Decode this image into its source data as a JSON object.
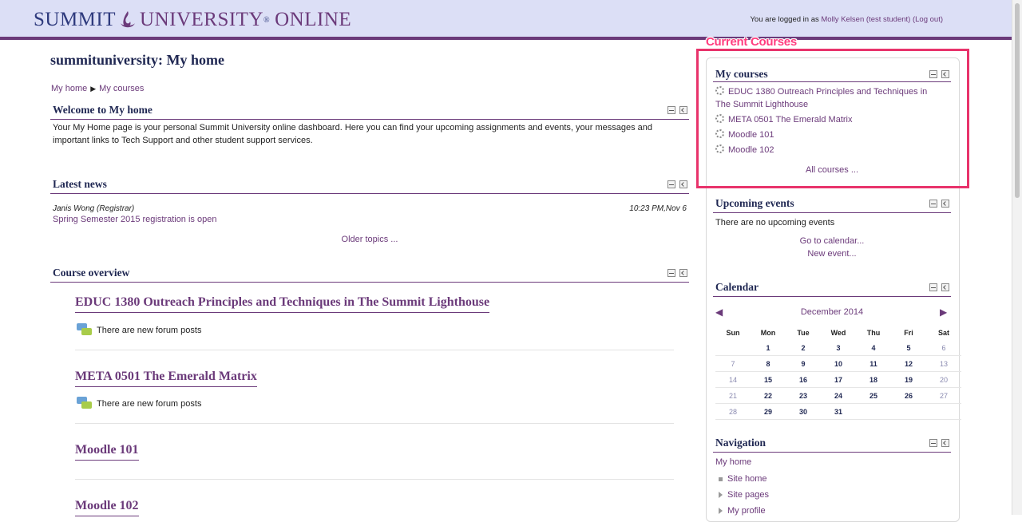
{
  "header": {
    "logo_summit": "SUMMIT",
    "logo_university": "UNIVERSITY",
    "logo_reg": "®",
    "logo_online": "ONLINE",
    "login_prefix": "You are logged in as ",
    "login_user": "Molly Kelsen (test student)",
    "logout": "(Log out)"
  },
  "page": {
    "title": "summituniversity: My home",
    "breadcrumb_home": "My home",
    "breadcrumb_sep": "▶",
    "breadcrumb_courses": "My courses"
  },
  "welcome": {
    "title": "Welcome to My home",
    "body": "Your My Home page is your personal Summit University online dashboard.  Here you can find your upcoming assignments and events, your messages and important links to Tech Support and other student support services."
  },
  "news": {
    "title": "Latest news",
    "author": "Janis Wong (Registrar)",
    "date": "10:23 PM,Nov 6",
    "headline": "Spring Semester 2015 registration is open",
    "older": "Older topics ..."
  },
  "overview": {
    "title": "Course overview",
    "courses": [
      {
        "name": "EDUC 1380 Outreach Principles and Techniques in The Summit Lighthouse",
        "note": "There are new forum posts"
      },
      {
        "name": "META 0501 The Emerald Matrix",
        "note": "There are new forum posts"
      },
      {
        "name": "Moodle 101",
        "note": ""
      },
      {
        "name": "Moodle 102",
        "note": ""
      }
    ]
  },
  "annotation": "Current Courses",
  "my_courses": {
    "title": "My courses",
    "items": [
      "EDUC 1380 Outreach Principles and Techniques in The Summit Lighthouse",
      "META 0501 The Emerald Matrix",
      "Moodle 101",
      "Moodle 102"
    ],
    "all": "All courses ..."
  },
  "events": {
    "title": "Upcoming events",
    "none": "There are no upcoming events",
    "calendar_link": "Go to calendar...",
    "new_event": "New event..."
  },
  "calendar": {
    "title": "Calendar",
    "month": "December 2014",
    "prev": "◀",
    "next": "▶",
    "days": [
      "Sun",
      "Mon",
      "Tue",
      "Wed",
      "Thu",
      "Fri",
      "Sat"
    ],
    "weeks": [
      [
        "",
        "1",
        "2",
        "3",
        "4",
        "5",
        "6"
      ],
      [
        "7",
        "8",
        "9",
        "10",
        "11",
        "12",
        "13"
      ],
      [
        "14",
        "15",
        "16",
        "17",
        "18",
        "19",
        "20"
      ],
      [
        "21",
        "22",
        "23",
        "24",
        "25",
        "26",
        "27"
      ],
      [
        "28",
        "29",
        "30",
        "31",
        "",
        "",
        ""
      ]
    ]
  },
  "navigation": {
    "title": "Navigation",
    "home": "My home",
    "items": [
      "Site home",
      "Site pages",
      "My profile"
    ]
  },
  "colors": {
    "accent": "#6b3a7a",
    "heading": "#1f2752",
    "header_bg": "#dcdff6",
    "highlight": "#e8336b"
  }
}
